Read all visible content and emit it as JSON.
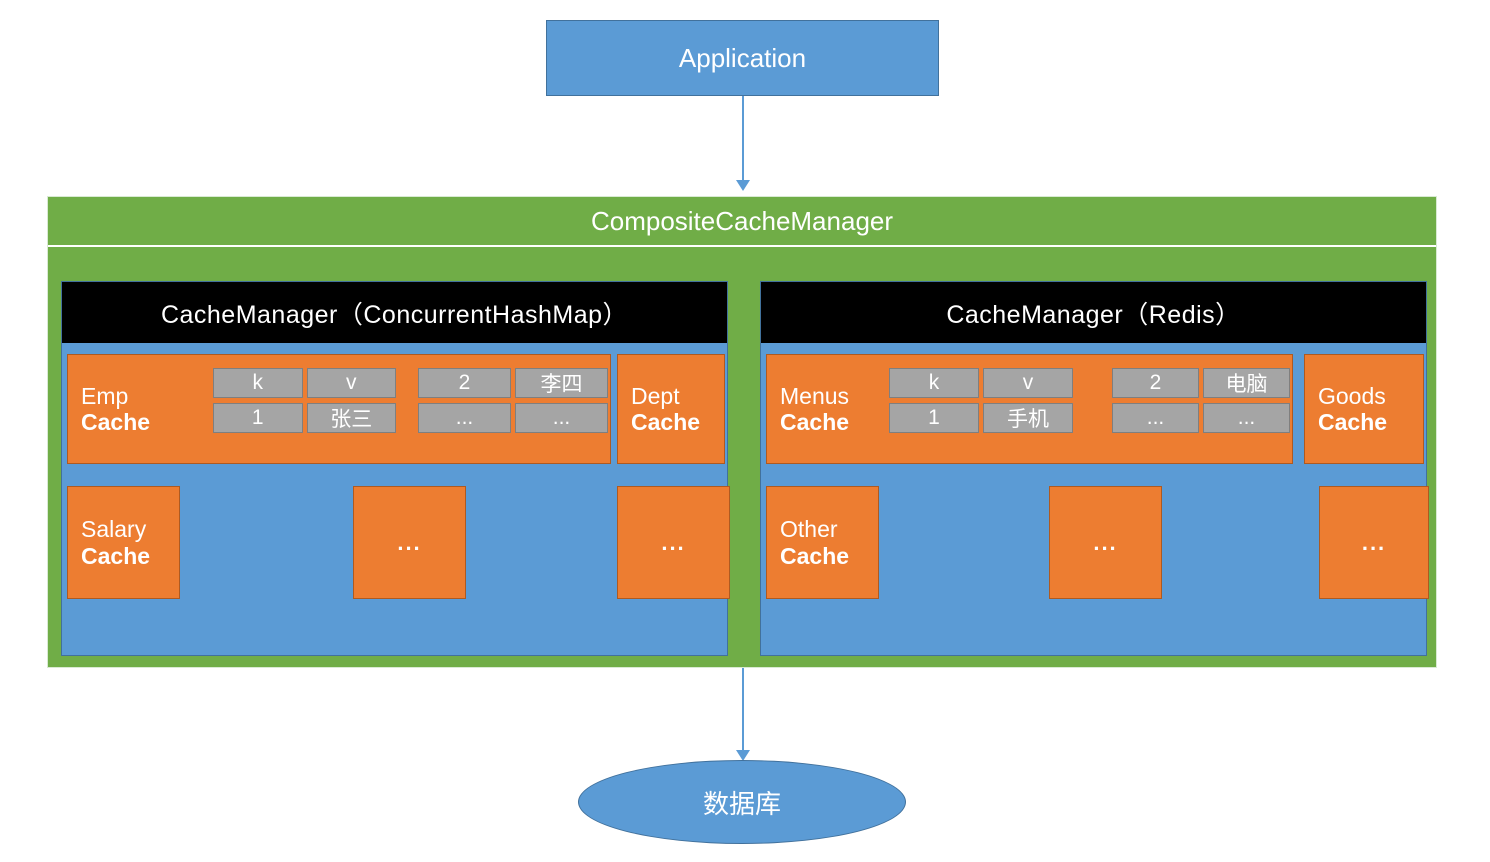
{
  "application": {
    "label": "Application"
  },
  "composite": {
    "title": "CompositeCacheManager"
  },
  "panels": [
    {
      "header": "CacheManager（ConcurrentHashMap）",
      "top_row": {
        "main_cache": {
          "line1": "Emp",
          "line2": "Cache"
        },
        "table_left": {
          "header_k": "k",
          "header_v": "v",
          "row_k": "1",
          "row_v": "张三"
        },
        "table_right": {
          "header_k": "2",
          "header_v": "李四",
          "row_k": "...",
          "row_v": "..."
        },
        "side_cache": {
          "line1": "Dept",
          "line2": "Cache"
        }
      },
      "bottom_row": {
        "main_cache": {
          "line1": "Salary",
          "line2": "Cache"
        },
        "mid_box": "...",
        "side_box": "..."
      }
    },
    {
      "header": "CacheManager（Redis）",
      "top_row": {
        "main_cache": {
          "line1": "Menus",
          "line2": "Cache"
        },
        "table_left": {
          "header_k": "k",
          "header_v": "v",
          "row_k": "1",
          "row_v": "手机"
        },
        "table_right": {
          "header_k": "2",
          "header_v": "电脑",
          "row_k": "...",
          "row_v": "..."
        },
        "side_cache": {
          "line1": "Goods",
          "line2": "Cache"
        }
      },
      "bottom_row": {
        "main_cache": {
          "line1": "Other",
          "line2": "Cache"
        },
        "mid_box": "...",
        "side_box": "..."
      }
    }
  ],
  "database": {
    "label": "数据库"
  },
  "colors": {
    "blue": "#5B9BD5",
    "green": "#70AD47",
    "orange": "#ED7D31",
    "gray": "#A5A5A5",
    "black": "#000000",
    "white": "#FFFFFF"
  }
}
